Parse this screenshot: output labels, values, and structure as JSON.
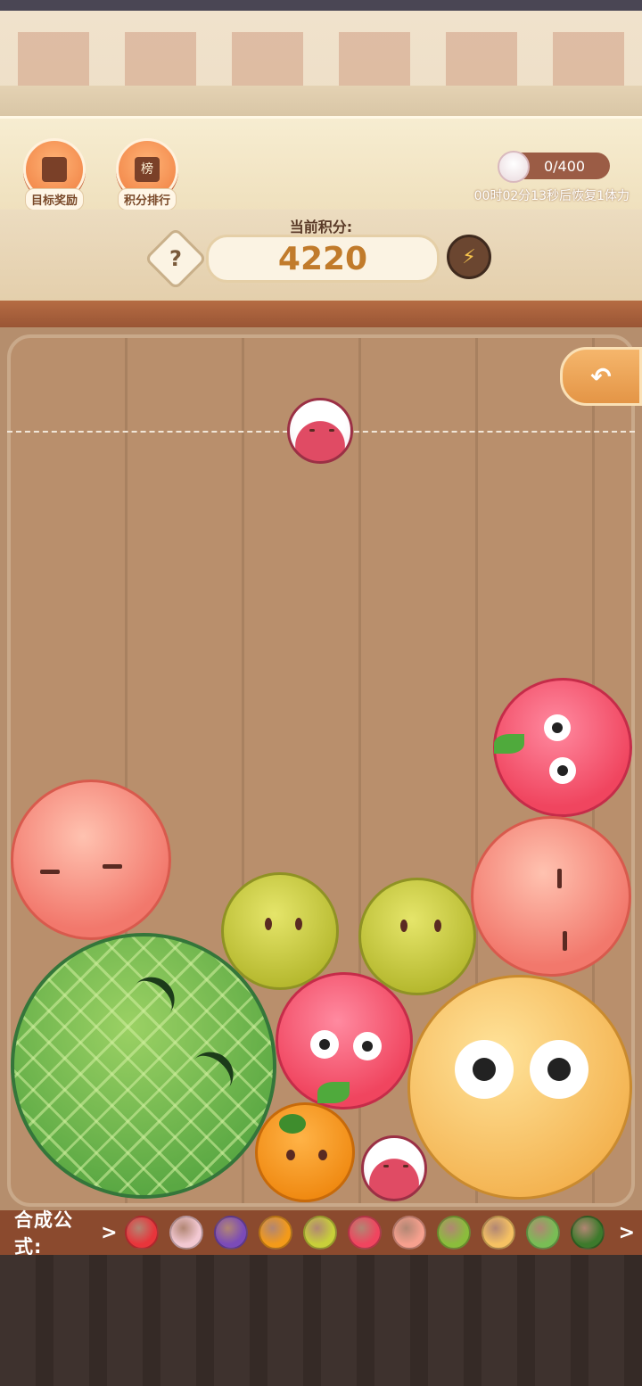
{
  "header": {
    "goal_reward_label": "目标奖励",
    "ranking_label": "积分排行",
    "ranking_glyph": "榜",
    "stamina_value": "0/400",
    "stamina_timer": "00时02分13秒后恢复1体力"
  },
  "score": {
    "title": "当前积分:",
    "value": "4220",
    "help_symbol": "?",
    "boost_symbol": "⚡"
  },
  "field": {
    "return_symbol": "↶",
    "next_fruit": "lychee",
    "fruits": [
      "peach",
      "apple",
      "peach",
      "lemon",
      "lemon",
      "melon",
      "apple",
      "cantaloupe",
      "orange",
      "lychee"
    ]
  },
  "formula": {
    "label": "合成公式:",
    "arrow_left": ">",
    "arrow_right": ">",
    "chain": [
      "cherry",
      "lychee",
      "plum",
      "orange",
      "lemon",
      "apple",
      "peach",
      "kiwi",
      "cantaloupe",
      "melon",
      "watermelon"
    ],
    "colors": {
      "cherry": "#e8353b",
      "lychee": "#f2c8d2",
      "plum": "#7b4bb8",
      "orange": "#f39a1a",
      "lemon": "#c8cf3a",
      "apple": "#f0455f",
      "peach": "#f6a08e",
      "kiwi": "#8bbd3c",
      "cantaloupe": "#f5c163",
      "melon": "#79bd55",
      "watermelon": "#3d7a2c"
    }
  }
}
